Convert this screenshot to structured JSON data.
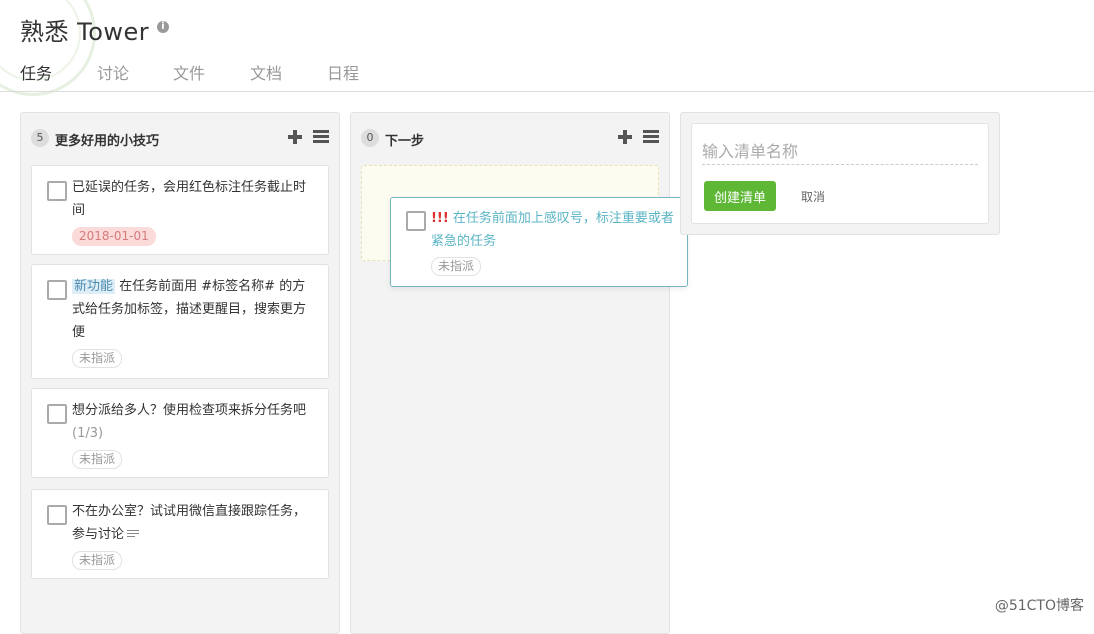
{
  "project": {
    "title": "熟悉 Tower",
    "info_icon": "i"
  },
  "tabs": [
    {
      "label": "任务",
      "active": true
    },
    {
      "label": "讨论"
    },
    {
      "label": "文件"
    },
    {
      "label": "文档"
    },
    {
      "label": "日程"
    }
  ],
  "columns": [
    {
      "count": "5",
      "title": "更多好用的小技巧",
      "cards": [
        {
          "text": "已延误的任务，会用红色标注任务截止时间",
          "badge": "2018-01-01"
        },
        {
          "tag": "新功能",
          "text": " 在任务前面用 #标签名称# 的方式给任务加标签，描述更醒目，搜索更方便",
          "badge": "未指派"
        },
        {
          "text": "想分派给多人？使用检查项来拆分任务吧",
          "progress": " (1/3)",
          "badge": "未指派"
        },
        {
          "text": "不在办公室？试试用微信直接跟踪任务，参与讨论",
          "badge": "未指派"
        }
      ]
    },
    {
      "count": "0",
      "title": "下一步"
    }
  ],
  "dragging_card": {
    "prefix": "!!!",
    "text": " 在任务前面加上感叹号，标注重要或者紧急的任务",
    "badge": "未指派"
  },
  "new_list": {
    "placeholder": "输入清单名称",
    "create_label": "创建清单",
    "cancel_label": "取消"
  },
  "watermark": "@51CTO博客",
  "colors": {
    "accent_green": "#5fb736",
    "due_red": "#d77b7b",
    "drag_text": "#5ab5c5"
  }
}
